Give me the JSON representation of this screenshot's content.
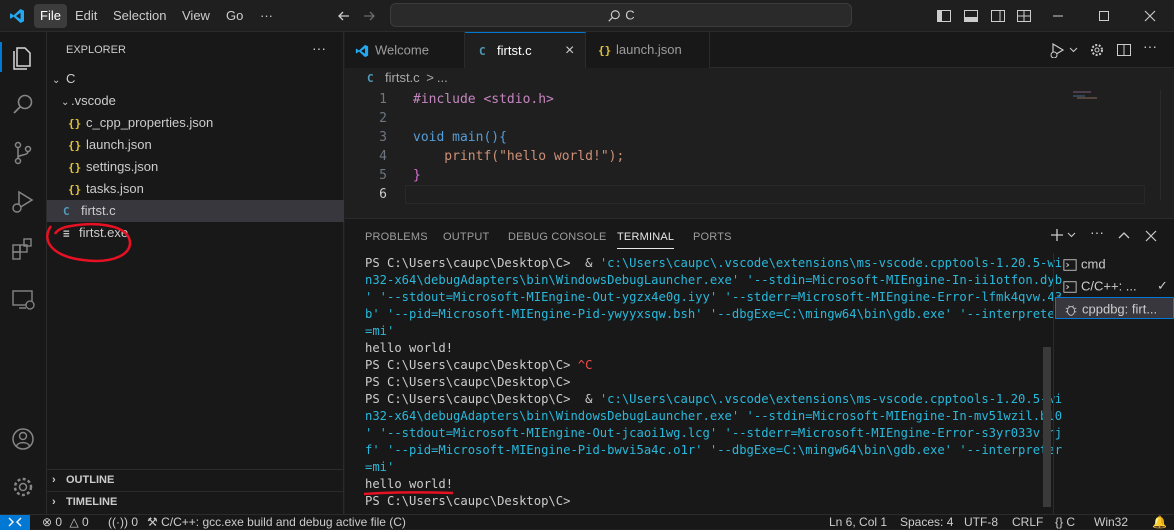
{
  "menu": [
    "File",
    "Edit",
    "Selection",
    "View",
    "Go",
    "···"
  ],
  "search": {
    "text": "C"
  },
  "sidebar": {
    "title": "EXPLORER",
    "more": "···",
    "root": "C",
    "items": [
      {
        "label": "C",
        "kind": "folder"
      },
      {
        "label": ".vscode",
        "kind": "folder"
      },
      {
        "label": "c_cpp_properties.json",
        "kind": "json",
        "icon": "{}"
      },
      {
        "label": "launch.json",
        "kind": "json",
        "icon": "{}"
      },
      {
        "label": "settings.json",
        "kind": "json",
        "icon": "{}"
      },
      {
        "label": "tasks.json",
        "kind": "json",
        "icon": "{}"
      },
      {
        "label": "firtst.c",
        "kind": "c",
        "icon": "C"
      },
      {
        "label": "firtst.exe",
        "kind": "exe",
        "icon": "≡"
      }
    ],
    "outline": "OUTLINE",
    "timeline": "TIMELINE"
  },
  "tabs": [
    {
      "label": "Welcome",
      "icon": "vscode"
    },
    {
      "label": "firtst.c",
      "icon": "C",
      "close": "×"
    },
    {
      "label": "launch.json",
      "icon": "{}"
    }
  ],
  "breadcrumb": {
    "file": "firtst.c",
    "sep": ">",
    "rest": "..."
  },
  "editor": {
    "lines": [
      "1",
      "2",
      "3",
      "4",
      "5",
      "6"
    ],
    "code": [
      "#include <stdio.h>",
      "",
      "void main(){",
      "    printf(\"hello world!\");",
      "}",
      ""
    ]
  },
  "panel": {
    "tabs": [
      "PROBLEMS",
      "OUTPUT",
      "DEBUG CONSOLE",
      "TERMINAL",
      "PORTS"
    ],
    "active": "TERMINAL",
    "terminal_lines": [
      {
        "text": "PS C:\\Users\\caupc\\Desktop\\C>  & ",
        "cyan": "'c:\\Users\\caupc\\.vscode\\extensions\\ms-vscode.cpptools-1.20.5-wi"
      },
      {
        "text": "",
        "cyan": "n32-x64\\debugAdapters\\bin\\WindowsDebugLauncher.exe' '--stdin=Microsoft-MIEngine-In-ii1otfon.dyb"
      },
      {
        "text": "",
        "cyan": "' '--stdout=Microsoft-MIEngine-Out-ygzx4e0g.iyy' '--stderr=Microsoft-MIEngine-Error-lfmk4qvw.43"
      },
      {
        "text": "",
        "cyan": "b' '--pid=Microsoft-MIEngine-Pid-ywyyxsqw.bsh' '--dbgExe=C:\\mingw64\\bin\\gdb.exe' '--interpreter"
      },
      {
        "text": "",
        "cyan": "=mi'"
      },
      {
        "text": "hello world!",
        "cyan": ""
      },
      {
        "text": "PS C:\\Users\\caupc\\Desktop\\C> ",
        "red": "^C"
      },
      {
        "text": "PS C:\\Users\\caupc\\Desktop\\C>",
        "cyan": ""
      },
      {
        "text": "PS C:\\Users\\caupc\\Desktop\\C>  & ",
        "cyan": "'c:\\Users\\caupc\\.vscode\\extensions\\ms-vscode.cpptools-1.20.5-wi"
      },
      {
        "text": "",
        "cyan": "n32-x64\\debugAdapters\\bin\\WindowsDebugLauncher.exe' '--stdin=Microsoft-MIEngine-In-mv51wzil.bl0"
      },
      {
        "text": "",
        "cyan": "' '--stdout=Microsoft-MIEngine-Out-jcaoi1wg.lcg' '--stderr=Microsoft-MIEngine-Error-s3yr033v.rj"
      },
      {
        "text": "",
        "cyan": "f' '--pid=Microsoft-MIEngine-Pid-bwvi5a4c.o1r' '--dbgExe=C:\\mingw64\\bin\\gdb.exe' '--interpreter"
      },
      {
        "text": "",
        "cyan": "=mi'"
      },
      {
        "text": "hello world!",
        "cyan": ""
      },
      {
        "text": "PS C:\\Users\\caupc\\Desktop\\C>",
        "cyan": ""
      }
    ],
    "terminals": [
      "cmd",
      "C/C++: ...",
      "cppdbg: firt..."
    ]
  },
  "status": {
    "errors": "0",
    "warnings": "0",
    "ports": "0",
    "task": "C/C++: gcc.exe build and debug active file (C)",
    "position": "Ln 6, Col 1",
    "spaces": "Spaces: 4",
    "encoding": "UTF-8",
    "eol": "CRLF",
    "language": "C",
    "platform": "Win32"
  },
  "colors": {
    "accent": "#0078d4",
    "annotation": "#e81123"
  }
}
